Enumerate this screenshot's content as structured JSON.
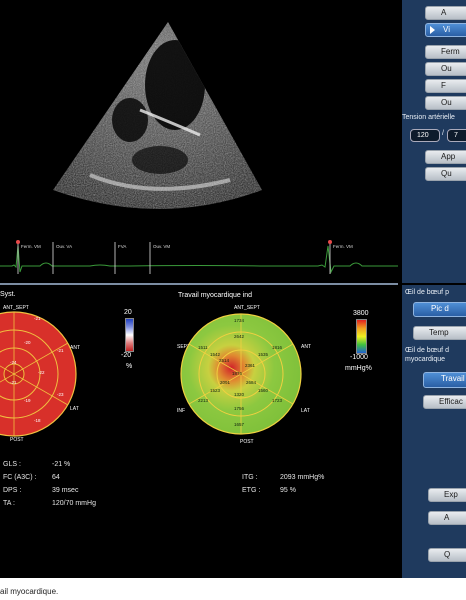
{
  "colors": {
    "panel_bg": "#1f3a5e",
    "button_blue": "#3a75c0",
    "echo_bg": "#000000",
    "ecg_line": "#3a9a3a"
  },
  "ecg": {
    "labels": [
      "Ferm. VM",
      "Ouv. VA",
      "FVA",
      "Ouv. VM",
      "Ferm. VM"
    ]
  },
  "right_panel": {
    "top_buttons": [
      "A",
      "Vi",
      "Ferm",
      "Ou",
      "F",
      "Ou"
    ],
    "tension_label": "Tension artérielle",
    "tension_sys": "120",
    "tension_dia": "7",
    "mid_buttons": [
      "App",
      "Qu"
    ],
    "section1_title": "Œil de bœuf p",
    "section1_buttons": [
      "Pic d",
      "Temp"
    ],
    "section2_title_line1": "Œil de bœuf d",
    "section2_title_line2": "myocardique",
    "section2_buttons": [
      "Travail m",
      "Efficac"
    ],
    "bottom_buttons": [
      "Exp",
      "A",
      "Q"
    ]
  },
  "strain_map": {
    "title": "Syst.",
    "label_top": "ANT_SEPT",
    "label_bottom": "POST",
    "labels_right": [
      "ANT",
      "LAT"
    ],
    "segment_values": [
      "-21",
      "-21",
      "-23",
      "-18",
      "-20",
      "-22",
      "-19",
      "-24",
      "-21"
    ],
    "scale_max": "20",
    "scale_min": "-20",
    "unit": "%"
  },
  "work_map": {
    "title": "Travail myocardique ind",
    "label_top": "ANT_SEPT",
    "label_bottom": "POST",
    "label_left_top": "SEPT",
    "label_left_bottom": "INF",
    "label_right_top": "ANT",
    "label_right_bottom": "LAT",
    "outer_values": [
      "1734",
      "1816",
      "1723",
      "1657",
      "2213",
      "1511"
    ],
    "mid_values": [
      "2642",
      "1535",
      "1560",
      "1756",
      "1523",
      "1542"
    ],
    "apex_values": [
      "2514",
      "2361",
      "2684",
      "1320",
      "2091",
      "1876"
    ],
    "scale_max": "3800",
    "scale_min": "-1000",
    "unit": "mmHg%"
  },
  "stats_left": [
    {
      "label": "GLS :",
      "value": "-21 %"
    },
    {
      "label": "FC (A3C) :",
      "value": "64"
    },
    {
      "label": "DPS :",
      "value": "39 msec"
    },
    {
      "label": "TA :",
      "value": "120/70 mmHg"
    }
  ],
  "stats_right": [
    {
      "label": "ITG :",
      "value": "2093 mmHg%"
    },
    {
      "label": "ETG :",
      "value": "95 %"
    }
  ],
  "caption": "ail myocardique."
}
